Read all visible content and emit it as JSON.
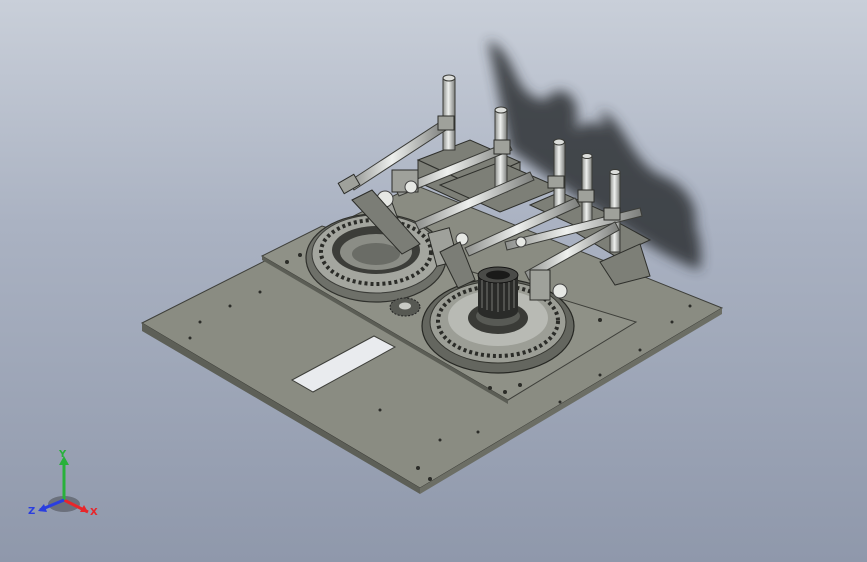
{
  "triad": {
    "x_label": "X",
    "y_label": "Y",
    "z_label": "Z"
  },
  "colors": {
    "background_top": "#c9cfd9",
    "background_bottom": "#8f98ab",
    "plate": "#8b8d83",
    "plate_edge": "#4a4b45",
    "steel": "#c9cbc8",
    "shadow": "#3a3d40",
    "axis_x": "#e8262a",
    "axis_y": "#28b13a",
    "axis_z": "#2a3ee0"
  }
}
